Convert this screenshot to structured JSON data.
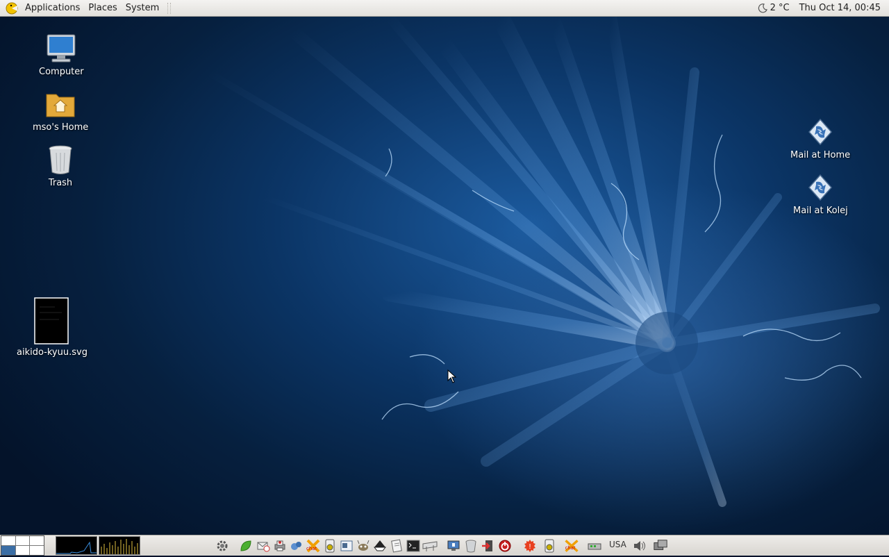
{
  "top_panel": {
    "menus": [
      "Applications",
      "Places",
      "System"
    ],
    "weather": {
      "icon": "moon-icon",
      "temp": "2 °C"
    },
    "clock": "Thu Oct 14, 00:45"
  },
  "desktop": {
    "icons": [
      {
        "name": "computer",
        "label": "Computer",
        "icon": "computer-icon"
      },
      {
        "name": "home",
        "label": "mso's Home",
        "icon": "home-folder-icon"
      },
      {
        "name": "trash",
        "label": "Trash",
        "icon": "trash-icon"
      },
      {
        "name": "svg-file",
        "label": "aikido-kyuu.svg",
        "icon": "svg-file-icon"
      },
      {
        "name": "mail-home",
        "label": "Mail at Home",
        "icon": "mail-launcher-icon"
      },
      {
        "name": "mail-kolej",
        "label": "Mail at Kolej",
        "icon": "mail-launcher-icon"
      }
    ]
  },
  "bottom_panel": {
    "workspaces": 6,
    "active_workspace": 4,
    "keyboard_layout": "USA",
    "launchers": [
      "gear-icon",
      "leaf-icon",
      "mail-clock-icon",
      "printer-icon",
      "bubbles-icon",
      "xchat-icon",
      "media-player-icon",
      "scanner-icon",
      "gimp-icon",
      "inkscape-icon",
      "notes-icon",
      "terminal-icon",
      "keyboard-icon"
    ],
    "tray": [
      "monitor-icon",
      "trash-icon",
      "logout-icon",
      "power-icon",
      "update-alert-icon",
      "media-player-icon",
      "xchat-icon",
      "network-icon",
      "volume-icon",
      "display-icon"
    ]
  },
  "colors": {
    "panel": "#e6e4e0",
    "wallpaper": "#0b3566",
    "accent": "#3b6ea5"
  }
}
